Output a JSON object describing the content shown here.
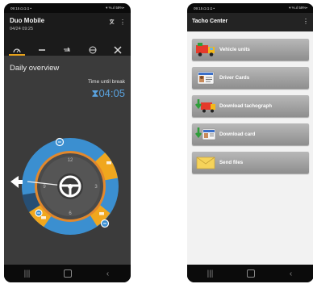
{
  "left_phone": {
    "status_bar": {
      "left": "09:15 ◘ ◘ ◘ •",
      "right": "▾ ℅.ıl 59%▪"
    },
    "header": {
      "title": "Duo Mobile",
      "datetime": "04/24 09:25"
    },
    "tabs": [
      {
        "name": "overview",
        "icon": "gauge-icon",
        "active": true
      },
      {
        "name": "driving",
        "icon": "road-icon",
        "active": false
      },
      {
        "name": "transfer",
        "icon": "arrows-icon",
        "active": false
      },
      {
        "name": "steering",
        "icon": "steering-wheel-icon",
        "active": false
      },
      {
        "name": "tools",
        "icon": "tools-icon",
        "active": false
      }
    ],
    "overview_title": "Daily overview",
    "time_until_break_label": "Time until break",
    "time_until_break_value": "04:05",
    "hourglass_symbol": "⧗",
    "colors": {
      "ring_blue": "#3b8fd0",
      "ring_orange": "#f0a71e",
      "clock_border": "#e2882c",
      "clock_face": "#4a4a4a"
    },
    "clock_ticks": [
      "12",
      "3",
      "6",
      "9"
    ]
  },
  "right_phone": {
    "status_bar": {
      "left": "09:15 ◘ ◘ ◘ •",
      "right": "▾ ℅.ıl 59%▪"
    },
    "header": {
      "title": "Tacho Center",
      "menu": "⋮"
    },
    "menu_items": [
      {
        "label": "Vehicle units",
        "icon": "truck-icon"
      },
      {
        "label": "Driver Cards",
        "icon": "driver-card-icon"
      },
      {
        "label": "Download tachograph",
        "icon": "download-tachograph-icon"
      },
      {
        "label": "Download card",
        "icon": "download-card-icon"
      },
      {
        "label": "Send files",
        "icon": "envelope-icon"
      }
    ]
  },
  "nav": {
    "recents": "|||",
    "back": "‹"
  }
}
